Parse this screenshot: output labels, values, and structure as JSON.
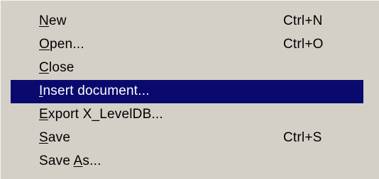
{
  "menu": {
    "items": [
      {
        "pre": "",
        "mnemonic": "N",
        "post": "ew",
        "shortcut": "Ctrl+N"
      },
      {
        "pre": "",
        "mnemonic": "O",
        "post": "pen...",
        "shortcut": "Ctrl+O"
      },
      {
        "pre": "",
        "mnemonic": "C",
        "post": "lose",
        "shortcut": ""
      },
      {
        "pre": "",
        "mnemonic": "I",
        "post": "nsert document...",
        "shortcut": ""
      },
      {
        "pre": "",
        "mnemonic": "E",
        "post": "xport X_LevelDB...",
        "shortcut": ""
      },
      {
        "pre": "",
        "mnemonic": "S",
        "post": "ave",
        "shortcut": "Ctrl+S"
      },
      {
        "pre": "Save ",
        "mnemonic": "A",
        "post": "s...",
        "shortcut": ""
      }
    ],
    "highlighted_index": 3
  },
  "colors": {
    "menu_background": "#d4d0c8",
    "highlight_background": "#0a0a6e",
    "highlight_text": "#ffffff",
    "text": "#000000"
  }
}
